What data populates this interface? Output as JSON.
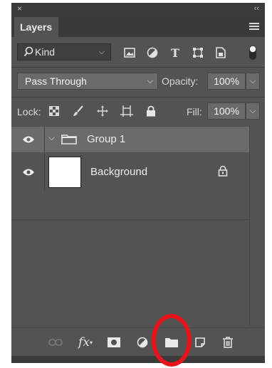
{
  "window": {
    "close_symbol": "×",
    "collapse_symbol": "‹‹"
  },
  "panel": {
    "tab_label": "Layers",
    "menu_icon": "panel-menu-icon"
  },
  "filter": {
    "kind_label": "Kind",
    "kind_icon": "search-icon",
    "icons": [
      "pixel-filter-icon",
      "adjustment-filter-icon",
      "type-filter-icon",
      "shape-filter-icon",
      "smart-object-filter-icon",
      "filter-toggle-icon"
    ]
  },
  "blend": {
    "mode": "Pass Through",
    "opacity_label": "Opacity:",
    "opacity_value": "100%"
  },
  "lock": {
    "label": "Lock:",
    "icons": [
      "lock-transparent-pixels-icon",
      "lock-image-pixels-icon",
      "lock-position-icon",
      "lock-artboard-icon",
      "lock-all-icon"
    ],
    "fill_label": "Fill:",
    "fill_value": "100%"
  },
  "layers": [
    {
      "name": "Group 1",
      "type": "group",
      "visible": true,
      "selected": true
    },
    {
      "name": "Background",
      "type": "pixel",
      "visible": true,
      "locked": true,
      "thumbnail_color": "#ffffff"
    }
  ],
  "bottom_bar": {
    "buttons": [
      "link-layers-icon",
      "layer-style-fx-icon",
      "add-mask-icon",
      "adjustment-layer-icon",
      "new-group-icon",
      "new-layer-icon",
      "delete-layer-icon"
    ],
    "fx_label": "fx",
    "highlighted_button": "new-group-icon",
    "highlight_color": "#e8141a"
  },
  "colors": {
    "panel_bg": "#535353",
    "selected_row": "#6b6b6b",
    "field_bg": "#6a6a6a"
  }
}
